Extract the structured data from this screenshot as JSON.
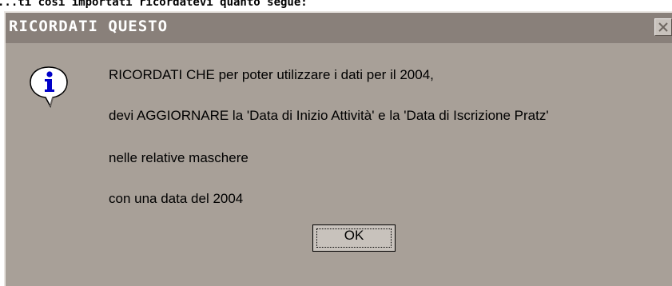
{
  "background_caption": "...ti così importati ricordatevi quanto segue:",
  "dialog": {
    "title": "RICORDATI QUESTO",
    "icon": "info-icon",
    "close_icon": "close-icon",
    "message_lines": [
      "RICORDATI CHE per poter utilizzare i dati per il 2004,",
      "devi AGGIORNARE la 'Data di Inizio Attività' e la 'Data di Iscrizione Pratz'",
      "nelle relative maschere",
      "con una data del 2004"
    ],
    "ok_label": "OK"
  },
  "colors": {
    "dialog_bg": "#a8a098",
    "titlebar_bg": "#89807a",
    "title_text": "#ffffff",
    "icon_blue": "#0000c8"
  }
}
